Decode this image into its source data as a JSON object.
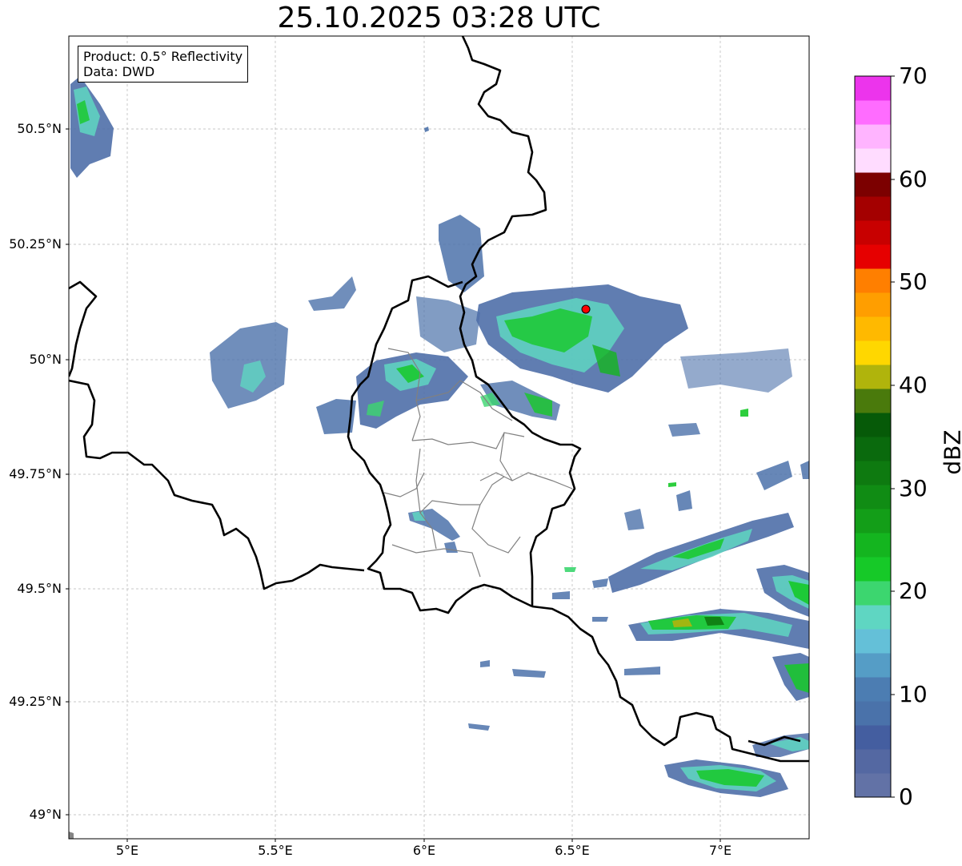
{
  "title": "25.10.2025 03:28 UTC",
  "info": {
    "product": "Product: 0.5° Reflectivity",
    "data_source": "Data: DWD"
  },
  "axes": {
    "lat_labels": [
      "50.5°N",
      "50.25°N",
      "50°N",
      "49.75°N",
      "49.5°N",
      "49.25°N",
      "49°N"
    ],
    "lon_labels": [
      "5°E",
      "5.5°E",
      "6°E",
      "6.5°E",
      "7°E"
    ]
  },
  "colorbar": {
    "title": "dBZ",
    "tick_labels": [
      "0",
      "10",
      "20",
      "30",
      "40",
      "50",
      "60",
      "70"
    ],
    "colors": [
      "#6272a6",
      "#5468a2",
      "#445ea0",
      "#4a72aa",
      "#4c7db2",
      "#559dc6",
      "#64c0d8",
      "#5fd6c2",
      "#3cd66f",
      "#16c928",
      "#14b51f",
      "#139e18",
      "#108c14",
      "#0e7a10",
      "#0a6a0d",
      "#065a08",
      "#4a7a0c",
      "#b0b40c",
      "#ffd700",
      "#ffb900",
      "#ff9e00",
      "#ff7f00",
      "#e60000",
      "#c80000",
      "#a40000",
      "#7c0000",
      "#ffdcff",
      "#ffb4ff",
      "#ff6cff",
      "#ec34ec"
    ]
  },
  "site_marker": {
    "label": "radar-site",
    "color": "#ff0000"
  }
}
